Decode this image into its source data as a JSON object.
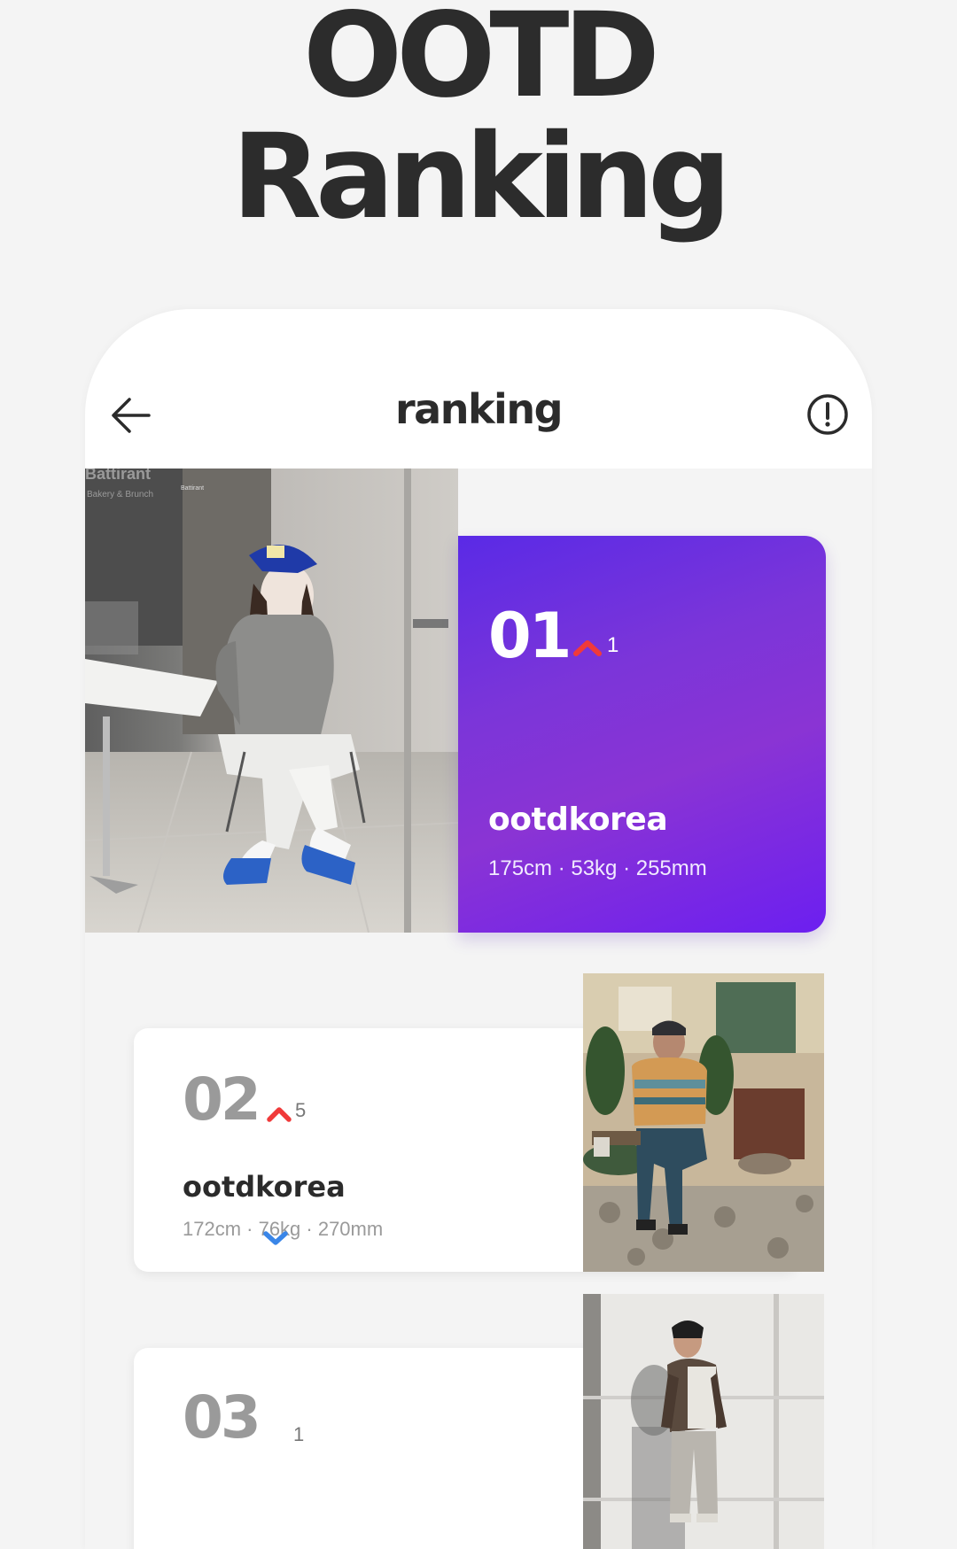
{
  "headline": {
    "line1": "OOTD",
    "line2": "Ranking"
  },
  "header": {
    "title": "ranking",
    "back_icon": "arrow-left-icon",
    "info_icon": "exclamation-circle-icon"
  },
  "rankings": [
    {
      "rank": "01",
      "change": "1",
      "direction": "up",
      "username": "ootdkorea",
      "stats": "175cm · 53kg · 255mm",
      "photo_sign_1": "Battirant",
      "photo_sign_2": "Bakery & Brunch",
      "photo_sign_3": "Battirant"
    },
    {
      "rank": "02",
      "change": "5",
      "direction": "up",
      "username": "ootdkorea",
      "stats": "172cm · 76kg · 270mm"
    },
    {
      "rank": "03",
      "change": "1"
    }
  ],
  "colors": {
    "accent_gradient_start": "#5a2ae6",
    "accent_gradient_end": "#6c1ff0",
    "rank_up": "#f03a3a",
    "rank_down": "#3a86e8",
    "headline": "#2c2c2c"
  }
}
